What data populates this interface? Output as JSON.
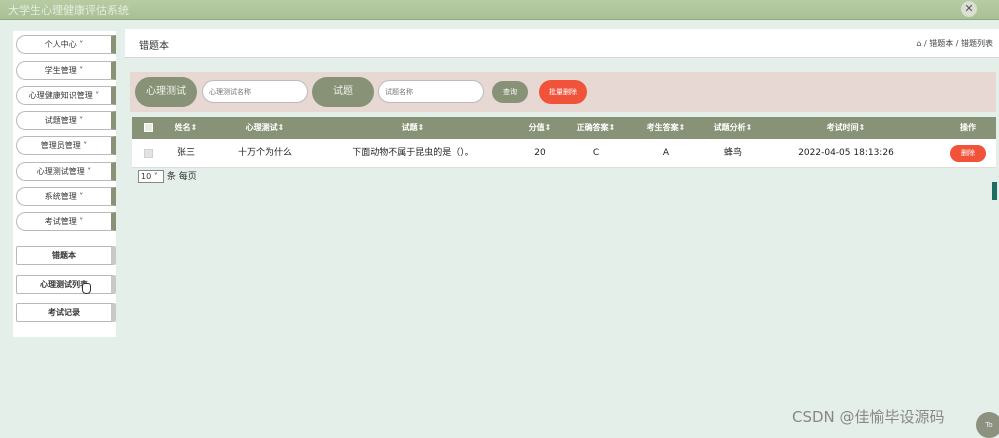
{
  "app": {
    "title": "大学生心理健康评估系统"
  },
  "sidebar": {
    "items": [
      {
        "label": "个人中心 ˅"
      },
      {
        "label": "学生管理 ˅"
      },
      {
        "label": "心理健康知识管理 ˅"
      },
      {
        "label": "试题管理 ˅"
      },
      {
        "label": "管理员管理 ˅"
      },
      {
        "label": "心理测试管理 ˅"
      },
      {
        "label": "系统管理 ˅"
      },
      {
        "label": "考试管理 ˅"
      },
      {
        "label": "错题本"
      },
      {
        "label": "心理测试列表"
      },
      {
        "label": "考试记录"
      }
    ]
  },
  "header": {
    "title": "错题本",
    "breadcrumb": "⌂ / 错题本 / 错题列表"
  },
  "search": {
    "test_label": "心理测试",
    "test_placeholder": "心理测试名称",
    "question_label": "试题",
    "question_placeholder": "试题名称",
    "query_button": "查询",
    "batch_delete_button": "批量删除"
  },
  "table": {
    "columns": [
      "姓名⇕",
      "心理测试⇕",
      "试题⇕",
      "分值⇕",
      "正确答案⇕",
      "考生答案⇕",
      "试题分析⇕",
      "考试时间⇕",
      "操作"
    ],
    "rows": [
      {
        "name": "张三",
        "test": "十万个为什么",
        "question": "下面动物不属于昆虫的是（）。",
        "score": "20",
        "correct": "C",
        "answer": "A",
        "analysis": "蜂鸟",
        "time": "2022-04-05 18:13:26",
        "delete": "删除"
      }
    ]
  },
  "pager": {
    "page_size": "10 ˅",
    "per_page": "条 每页"
  },
  "watermark": "CSDN @佳愉毕设源码",
  "to_top": "To"
}
